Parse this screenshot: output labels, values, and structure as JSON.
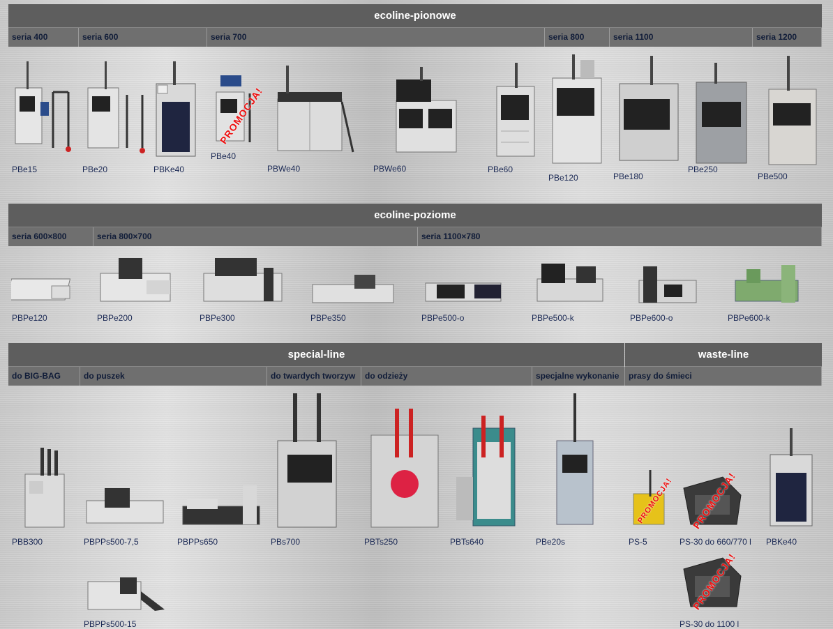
{
  "sections": {
    "pionowe": {
      "title": "ecoline-pionowe",
      "series": [
        "seria 400",
        "seria 600",
        "seria 700",
        "seria 800",
        "seria 1100",
        "seria 1200"
      ],
      "products": [
        "PBe15",
        "PBe20",
        "PBKe40",
        "PBe40",
        "PBWe40",
        "PBWe60",
        "PBe60",
        "PBe120",
        "PBe180",
        "PBe250",
        "PBe500"
      ]
    },
    "poziome": {
      "title": "ecoline-poziome",
      "series": [
        "seria 600×800",
        "seria 800×700",
        "seria 1100×780"
      ],
      "products": [
        "PBPe120",
        "PBPe200",
        "PBPe300",
        "PBPe350",
        "PBPe500-o",
        "PBPe500-k",
        "PBPe600-o",
        "PBPe600-k"
      ]
    },
    "special": {
      "title": "special-line",
      "series": [
        "do BIG-BAG",
        "do puszek",
        "do twardych tworzyw",
        "do odzieży",
        "specjalne wykonanie"
      ],
      "products": [
        "PBB300",
        "PBPPs500-7,5",
        "PBPPs650",
        "PBs700",
        "PBTs250",
        "PBTs640",
        "PBe20s",
        "PBPPs500-15"
      ]
    },
    "waste": {
      "title": "waste-line",
      "series": [
        "prasy do śmieci"
      ],
      "products": [
        "PS-5",
        "PS-30 do 660/770 l",
        "PBKe40",
        "PS-30 do 1100 l"
      ]
    }
  },
  "promo_text": "PROMOCJA!",
  "colors": {
    "header_bg": "#5e5e5e",
    "subheader_bg": "#6f6f6f",
    "label": "#1c2a55",
    "promo": "#ee1111"
  }
}
